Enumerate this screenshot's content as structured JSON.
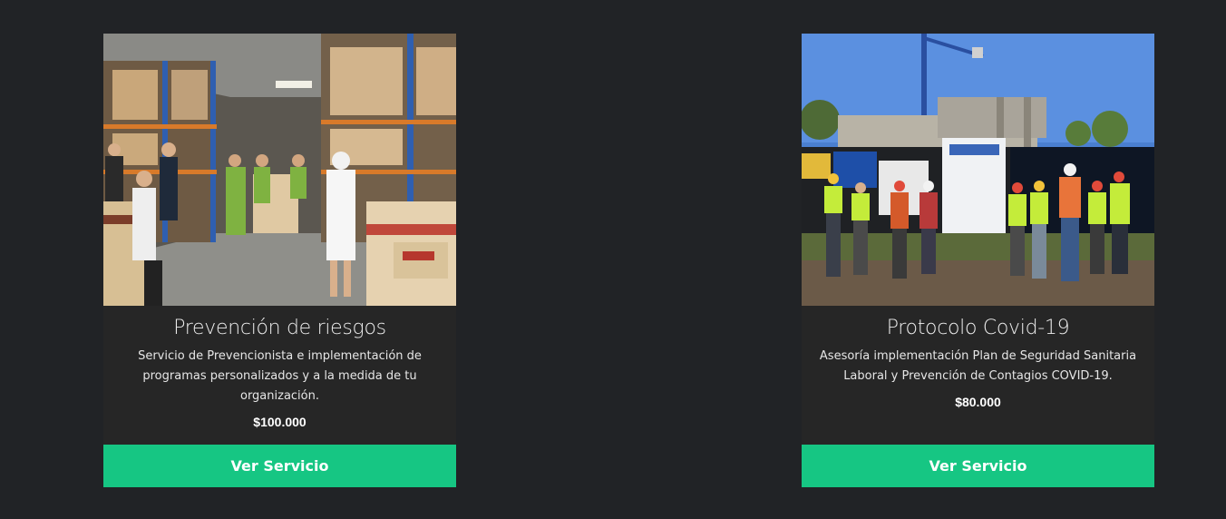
{
  "services": [
    {
      "title": "Prevención de riesgos",
      "description": "Servicio de Prevencionista e implementación de programas personalizados y a la medida de tu organización.",
      "price": "$100.000",
      "button_label": "Ver Servicio"
    },
    {
      "title": "Protocolo Covid-19",
      "description": "Asesoría implementación Plan de Seguridad Sanitaria Laboral y Prevención de Contagios COVID-19.",
      "price": "$80.000",
      "button_label": "Ver Servicio"
    }
  ],
  "colors": {
    "background": "#212326",
    "card": "#262626",
    "button": "#16c683"
  }
}
